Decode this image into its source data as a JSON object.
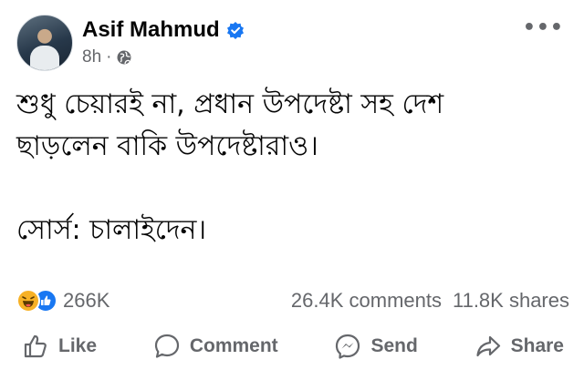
{
  "post": {
    "author": "Asif Mahmud",
    "time": "8h",
    "separator": "·",
    "text_lines": [
      "শুধু চেয়ারই না, প্রধান উপদেষ্টা সহ দেশ",
      "ছাড়লেন বাকি উপদেষ্টারাও।",
      "",
      "সোর্স: চালাইদেন।"
    ]
  },
  "stats": {
    "reactions": "266K",
    "comments": "26.4K comments",
    "shares": "11.8K shares"
  },
  "actions": {
    "like": "Like",
    "comment": "Comment",
    "send": "Send",
    "share": "Share"
  },
  "icons": {
    "verified": "verified-badge-icon",
    "privacy": "globe-icon",
    "more": "more-options-icon",
    "reaction_1": "haha-reaction-icon",
    "reaction_2": "like-reaction-icon"
  },
  "colors": {
    "text": "#050505",
    "secondary": "#65676b",
    "brand_blue": "#1877f2",
    "haha_yellow": "#f7b125"
  }
}
